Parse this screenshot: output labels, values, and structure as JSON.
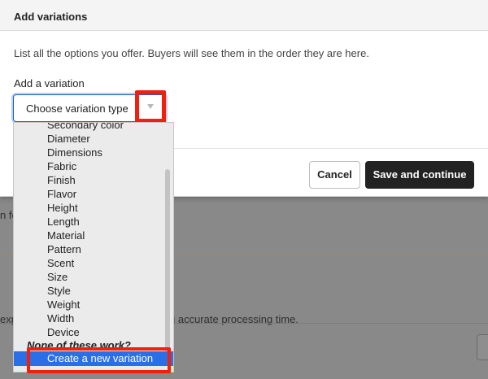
{
  "modal": {
    "title": "Add variations",
    "description": "List all the options you offer. Buyers will see them in the order they are here.",
    "field_label": "Add a variation",
    "select_value": "Choose variation type",
    "cancel_label": "Cancel",
    "save_label": "Save and continue"
  },
  "dropdown": {
    "items": [
      "Secondary color",
      "Diameter",
      "Dimensions",
      "Fabric",
      "Finish",
      "Flavor",
      "Height",
      "Length",
      "Material",
      "Pattern",
      "Scent",
      "Size",
      "Style",
      "Weight",
      "Width",
      "Device"
    ],
    "group_label": "None of these work?",
    "selected_item": "Create a new variation"
  },
  "background": {
    "fragment_1": "n fo",
    "fragment_2": "exp",
    "fragment_3": "g accurate processing time."
  },
  "colors": {
    "highlight": "#f21f0c",
    "selection": "#2a6fe8",
    "primary_button": "#222222"
  }
}
